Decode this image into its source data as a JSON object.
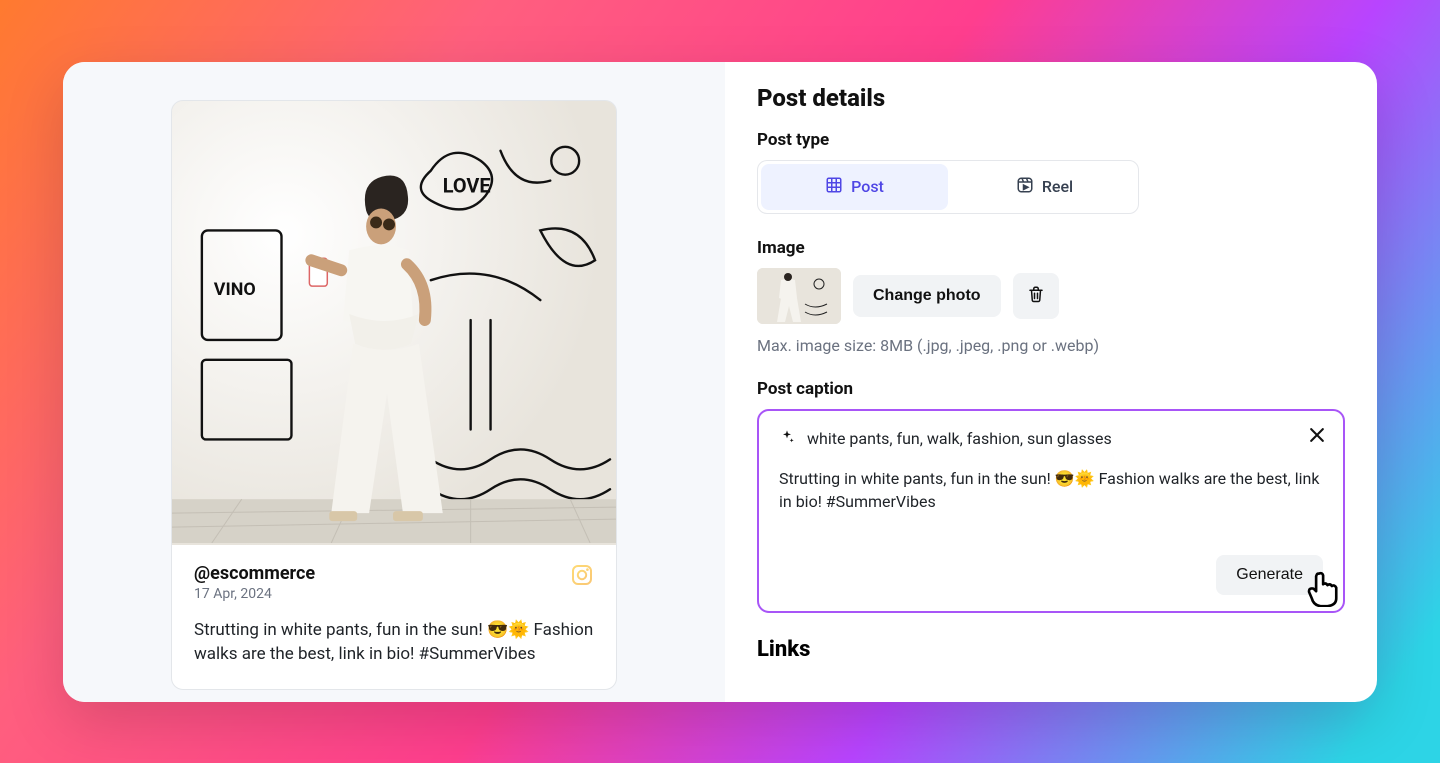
{
  "preview": {
    "handle": "@escommerce",
    "date": "17 Apr, 2024",
    "caption": "Strutting in white pants, fun in the sun! 😎🌞 Fashion walks are the best, link in bio! #SummerVibes"
  },
  "details": {
    "title": "Post details",
    "post_type_label": "Post type",
    "options": {
      "post": "Post",
      "reel": "Reel"
    },
    "image_label": "Image",
    "change_photo": "Change photo",
    "image_helper": "Max. image size: 8MB (.jpg, .jpeg, .png or .webp)",
    "caption_label": "Post caption",
    "tags": "white pants, fun, walk, fashion, sun glasses",
    "generated": "Strutting in white pants, fun in the sun! 😎🌞 Fashion walks are the best, link in bio! #SummerVibes",
    "generate_btn": "Generate",
    "links_title": "Links"
  }
}
